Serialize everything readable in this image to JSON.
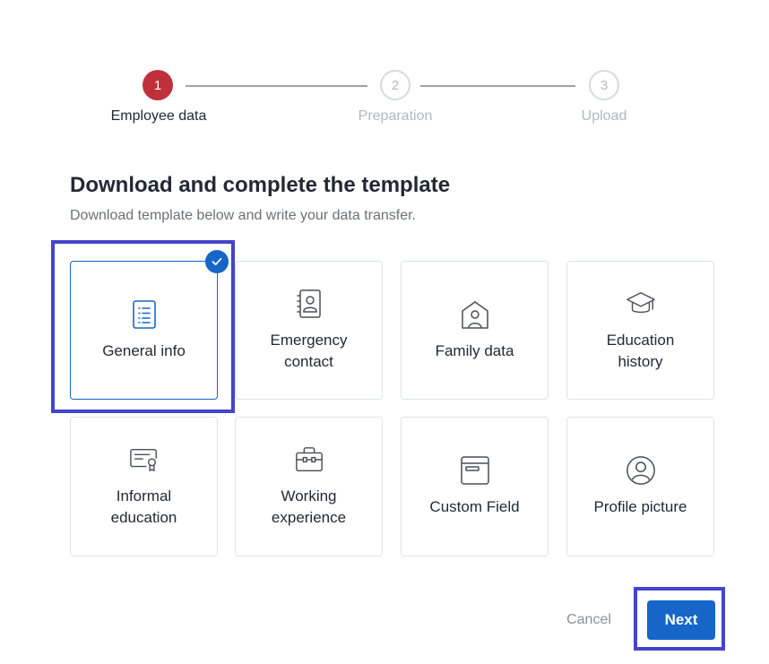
{
  "stepper": {
    "steps": [
      {
        "number": "1",
        "label": "Employee data",
        "state": "active"
      },
      {
        "number": "2",
        "label": "Preparation",
        "state": "inactive"
      },
      {
        "number": "3",
        "label": "Upload",
        "state": "inactive"
      }
    ]
  },
  "main": {
    "title": "Download and complete the template",
    "subtitle": "Download template below and write your data transfer."
  },
  "templates": [
    {
      "label": "General info",
      "icon": "document-list-icon",
      "selected": true
    },
    {
      "label": "Emergency contact",
      "icon": "contact-book-icon",
      "selected": false
    },
    {
      "label": "Family data",
      "icon": "home-person-icon",
      "selected": false
    },
    {
      "label": "Education history",
      "icon": "graduation-cap-icon",
      "selected": false
    },
    {
      "label": "Informal education",
      "icon": "certificate-icon",
      "selected": false
    },
    {
      "label": "Working experience",
      "icon": "briefcase-icon",
      "selected": false
    },
    {
      "label": "Custom Field",
      "icon": "window-icon",
      "selected": false
    },
    {
      "label": "Profile picture",
      "icon": "user-circle-icon",
      "selected": false
    }
  ],
  "footer": {
    "cancel_label": "Cancel",
    "next_label": "Next"
  },
  "colors": {
    "accent": "#1566c8",
    "active_step": "#c0303a",
    "inactive": "#b2b7bd",
    "highlight": "#4444cc"
  }
}
